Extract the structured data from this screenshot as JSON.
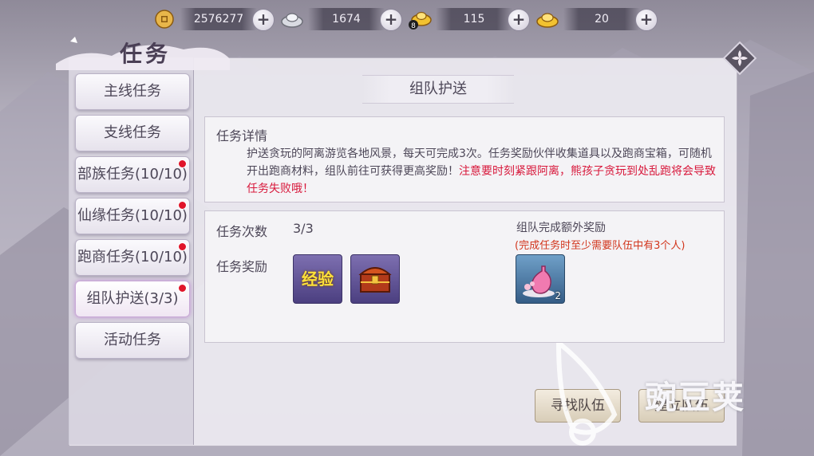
{
  "currencies": [
    {
      "icon": "copper-coin-icon",
      "value": "2576277"
    },
    {
      "icon": "silver-ingot-icon",
      "value": "1674"
    },
    {
      "icon": "gold-ingot-badge-icon",
      "badge": "8",
      "value": "115"
    },
    {
      "icon": "gold-ingot-icon",
      "value": "20"
    }
  ],
  "plus_label": "+",
  "title": "任务",
  "sidebar": {
    "items": [
      {
        "label": "主线任务",
        "dot": false
      },
      {
        "label": "支线任务",
        "dot": false
      },
      {
        "label": "部族任务(10/10)",
        "dot": true
      },
      {
        "label": "仙缘任务(10/10)",
        "dot": true
      },
      {
        "label": "跑商任务(10/10)",
        "dot": true
      },
      {
        "label": "组队护送(3/3)",
        "dot": true,
        "active": true
      },
      {
        "label": "活动任务",
        "dot": false
      }
    ]
  },
  "section": {
    "title": "组队护送",
    "detail_label": "任务详情",
    "detail_text": "护送贪玩的阿离游览各地风景，每天可完成3次。任务奖励伙伴收集道具以及跑商宝箱，可随机开出跑商材料，组队前往可获得更高奖励！",
    "detail_warning": "注意要时刻紧跟阿离，熊孩子贪玩到处乱跑将会导致任务失败哦！",
    "count_label": "任务次数",
    "count_value": "3/3",
    "reward_label": "任务奖励",
    "rewards": [
      {
        "icon": "exp-icon",
        "text": "经验"
      },
      {
        "icon": "treasure-chest-icon"
      }
    ],
    "extra_label": "组队完成额外奖励",
    "extra_note": "(完成任务时至少需要队伍中有3个人)",
    "extra_items": [
      {
        "icon": "vase-icon",
        "count": "2"
      }
    ]
  },
  "buttons": {
    "find_team": "寻找队伍",
    "create_team": "建立队伍"
  },
  "watermark": "豌豆荚",
  "colors": {
    "warning": "#d8193c",
    "note": "#d2361d",
    "dot": "#e0152a"
  }
}
